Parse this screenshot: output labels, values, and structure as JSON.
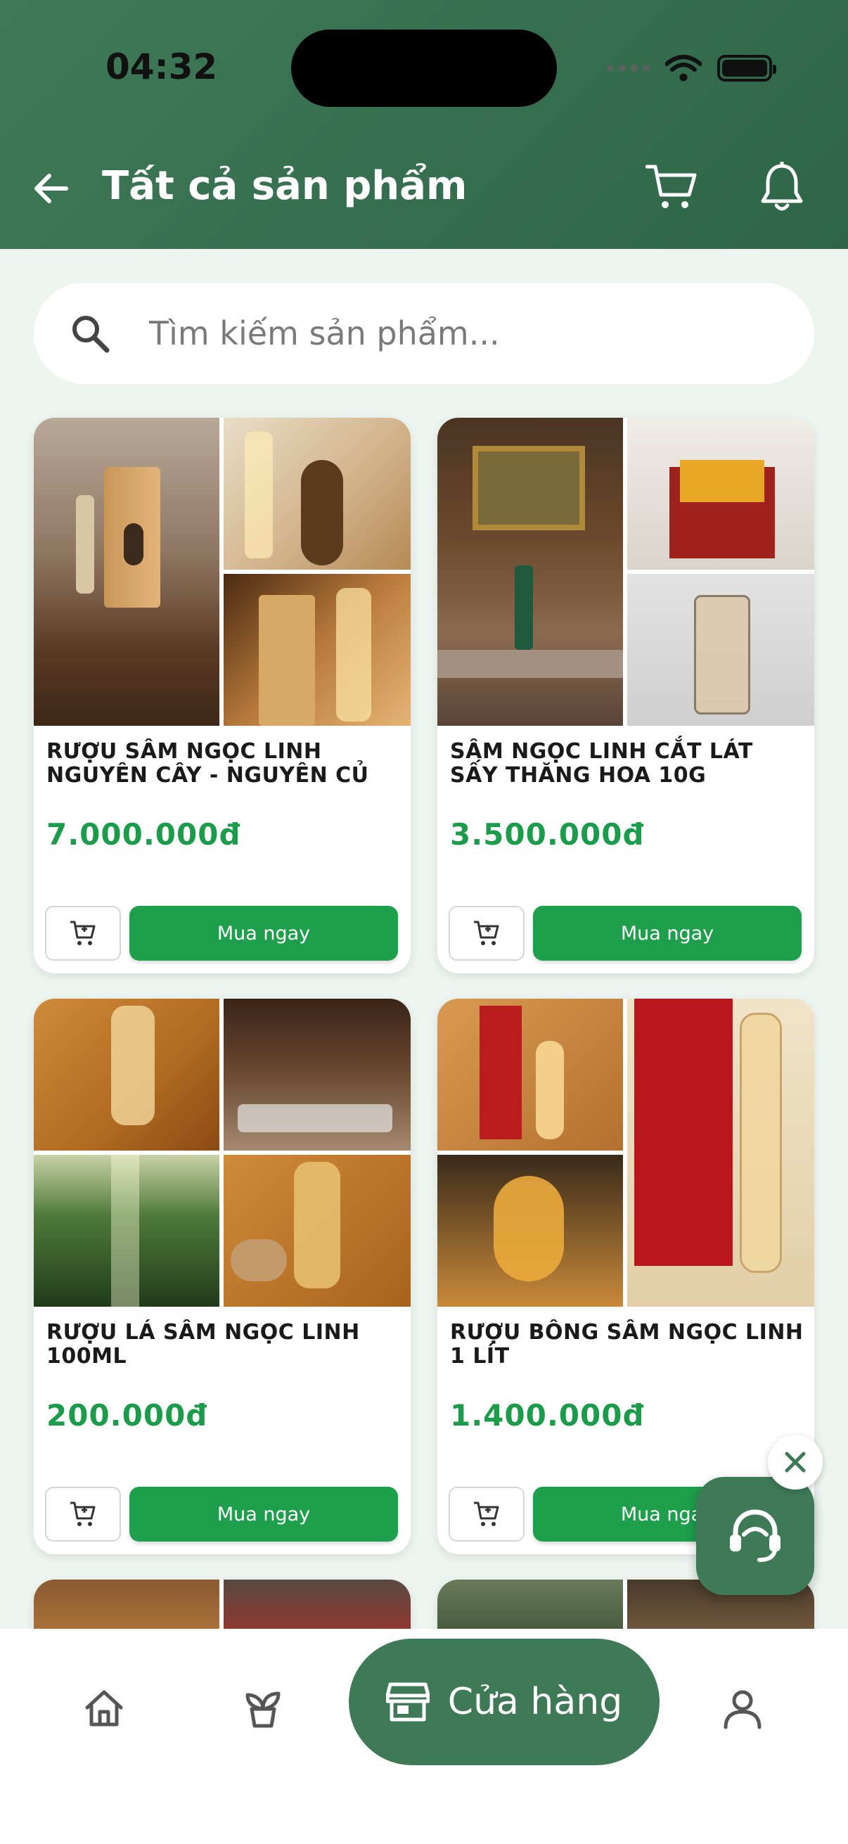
{
  "status_bar": {
    "time": "04:32"
  },
  "header": {
    "title": "Tất cả sản phẩm"
  },
  "search": {
    "placeholder": "Tìm kiếm sản phẩm..."
  },
  "products": [
    {
      "name": "RƯỢU SÂM NGỌC LINH NGUYÊN CÂY - NGUYÊN CỦ",
      "price": "7.000.000đ",
      "buy_label": "Mua ngay"
    },
    {
      "name": "SÂM NGỌC LINH CẮT LÁT SẤY THĂNG HOA 10G",
      "price": "3.500.000đ",
      "buy_label": "Mua ngay"
    },
    {
      "name": "RƯỢU LÁ SÂM NGỌC LINH 100ML",
      "price": "200.000đ",
      "buy_label": "Mua ngay"
    },
    {
      "name": "RƯỢU BÔNG SÂM NGỌC LINH 1 LÍT",
      "price": "1.400.000đ",
      "buy_label": "Mua ngay"
    }
  ],
  "bottom_nav": {
    "items": [
      {
        "icon": "home-icon"
      },
      {
        "icon": "plant-icon"
      },
      {
        "icon": "store-icon",
        "label": "Cửa hàng",
        "active": true
      },
      {
        "icon": "user-icon"
      }
    ]
  },
  "colors": {
    "header_bg": "#3f7a57",
    "accent_green": "#1d9f4b",
    "price_green": "#1b9c4a",
    "page_bg": "#eef5f0"
  }
}
